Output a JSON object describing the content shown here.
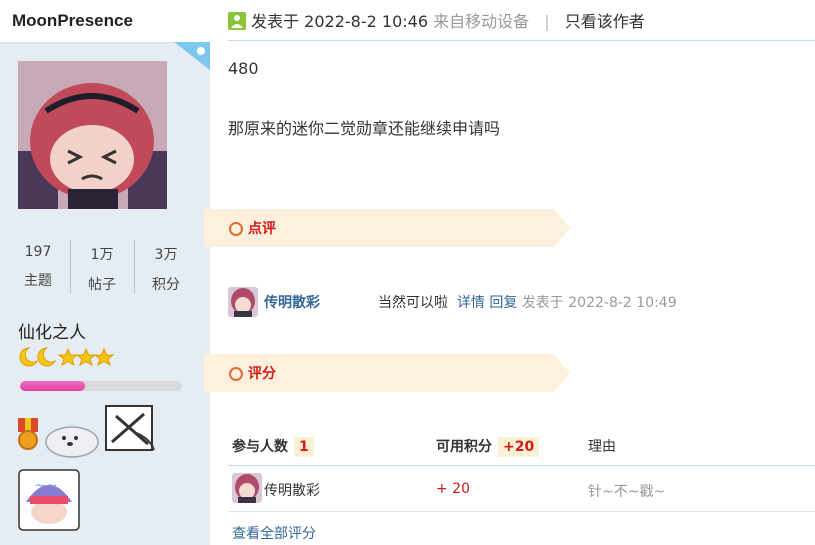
{
  "author": {
    "username": "MoonPresence",
    "stats": [
      {
        "value": "197",
        "label": "主题"
      },
      {
        "value": "1万",
        "label": "帖子"
      },
      {
        "value": "3万",
        "label": "积分"
      }
    ],
    "rank_title": "仙化之人",
    "level_progress": 0.4
  },
  "post": {
    "posted_label": "发表于 2022-8-2 10:46",
    "device_label": "来自移动设备",
    "only_author_label": "只看该作者",
    "lines": [
      "480",
      "那原来的迷你二觉勋章还能继续申请吗"
    ]
  },
  "comments_section": {
    "title": "点评",
    "items": [
      {
        "user": "传明散彩",
        "text": "当然可以啦",
        "detail_label": "详情",
        "reply_label": "回复",
        "time": "发表于 2022-8-2 10:49"
      }
    ]
  },
  "rating_section": {
    "title": "评分",
    "participants_label": "参与人数",
    "participants_count": "1",
    "points_label": "可用积分",
    "points_total": "+20",
    "reason_label": "理由",
    "rows": [
      {
        "user": "传明散彩",
        "score": "+ 20",
        "reason": "针~不~戳~"
      }
    ],
    "view_all_label": "查看全部评分"
  },
  "colors": {
    "sidebar_bg": "#e5edf2",
    "link": "#336699",
    "accent_red": "#d21a1a",
    "ribbon_bg": "#fdf0dc"
  }
}
